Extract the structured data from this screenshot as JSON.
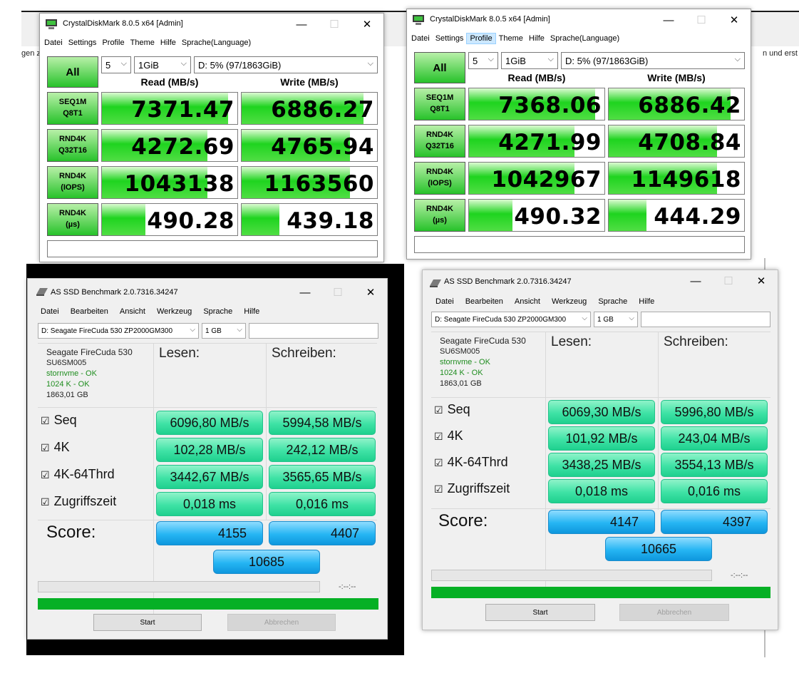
{
  "background": {
    "left_text": "gen z",
    "right_text": "n und erst"
  },
  "cdm_left": {
    "title": "CrystalDiskMark 8.0.5 x64 [Admin]",
    "menu": [
      "Datei",
      "Settings",
      "Profile",
      "Theme",
      "Hilfe",
      "Sprache(Language)"
    ],
    "all_label": "All",
    "count": "5",
    "size": "1GiB",
    "drive": "D: 5% (97/1863GiB)",
    "read_header": "Read (MB/s)",
    "write_header": "Write (MB/s)",
    "rows": [
      {
        "label1": "SEQ1M",
        "label2": "Q8T1",
        "read": "7371.47",
        "write": "6886.27",
        "read_fill": 0.93,
        "write_fill": 0.9
      },
      {
        "label1": "RND4K",
        "label2": "Q32T16",
        "read": "4272.69",
        "write": "4765.94",
        "read_fill": 0.78,
        "write_fill": 0.8
      },
      {
        "label1": "RND4K",
        "label2": "(IOPS)",
        "read": "1043138",
        "write": "1163560",
        "read_fill": 0.78,
        "write_fill": 0.8
      },
      {
        "label1": "RND4K",
        "label2": "(µs)",
        "read": "490.28",
        "write": "439.18",
        "read_fill": 0.32,
        "write_fill": 0.28
      }
    ]
  },
  "cdm_right": {
    "title": "CrystalDiskMark 8.0.5 x64 [Admin]",
    "menu": [
      "Datei",
      "Settings",
      "Profile",
      "Theme",
      "Hilfe",
      "Sprache(Language)"
    ],
    "all_label": "All",
    "count": "5",
    "size": "1GiB",
    "drive": "D: 5% (97/1863GiB)",
    "read_header": "Read (MB/s)",
    "write_header": "Write (MB/s)",
    "rows": [
      {
        "label1": "SEQ1M",
        "label2": "Q8T1",
        "read": "7368.06",
        "write": "6886.42",
        "read_fill": 0.93,
        "write_fill": 0.9
      },
      {
        "label1": "RND4K",
        "label2": "Q32T16",
        "read": "4271.99",
        "write": "4708.84",
        "read_fill": 0.78,
        "write_fill": 0.8
      },
      {
        "label1": "RND4K",
        "label2": "(IOPS)",
        "read": "1042967",
        "write": "1149618",
        "read_fill": 0.78,
        "write_fill": 0.8
      },
      {
        "label1": "RND4K",
        "label2": "(µs)",
        "read": "490.32",
        "write": "444.29",
        "read_fill": 0.32,
        "write_fill": 0.28
      }
    ]
  },
  "asssd_left": {
    "title": "AS SSD Benchmark 2.0.7316.34247",
    "menu": [
      "Datei",
      "Bearbeiten",
      "Ansicht",
      "Werkzeug",
      "Sprache",
      "Hilfe"
    ],
    "drive": "D: Seagate FireCuda 530 ZP2000GM300",
    "size": "1 GB",
    "info": {
      "model": "Seagate FireCuda 530",
      "firmware": "SU6SM005",
      "driver": "stornvme - OK",
      "align": "1024 K - OK",
      "capacity": "1863,01 GB"
    },
    "read_header": "Lesen:",
    "write_header": "Schreiben:",
    "rows": [
      {
        "label": "Seq",
        "read": "6096,80 MB/s",
        "write": "5994,58 MB/s"
      },
      {
        "label": "4K",
        "read": "102,28 MB/s",
        "write": "242,12 MB/s"
      },
      {
        "label": "4K-64Thrd",
        "read": "3442,67 MB/s",
        "write": "3565,65 MB/s"
      },
      {
        "label": "Zugriffszeit",
        "read": "0,018 ms",
        "write": "0,016 ms"
      }
    ],
    "score_label": "Score:",
    "score_read": "4155",
    "score_write": "4407",
    "score_total": "10685",
    "timer": "-:--:--",
    "start": "Start",
    "abort": "Abbrechen"
  },
  "asssd_right": {
    "title": "AS SSD Benchmark 2.0.7316.34247",
    "menu": [
      "Datei",
      "Bearbeiten",
      "Ansicht",
      "Werkzeug",
      "Sprache",
      "Hilfe"
    ],
    "drive": "D: Seagate FireCuda 530 ZP2000GM300",
    "size": "1 GB",
    "info": {
      "model": "Seagate FireCuda 530",
      "firmware": "SU6SM005",
      "driver": "stornvme - OK",
      "align": "1024 K - OK",
      "capacity": "1863,01 GB"
    },
    "read_header": "Lesen:",
    "write_header": "Schreiben:",
    "rows": [
      {
        "label": "Seq",
        "read": "6069,30 MB/s",
        "write": "5996,80 MB/s"
      },
      {
        "label": "4K",
        "read": "101,92 MB/s",
        "write": "243,04 MB/s"
      },
      {
        "label": "4K-64Thrd",
        "read": "3438,25 MB/s",
        "write": "3554,13 MB/s"
      },
      {
        "label": "Zugriffszeit",
        "read": "0,018 ms",
        "write": "0,016 ms"
      }
    ],
    "score_label": "Score:",
    "score_read": "4147",
    "score_write": "4397",
    "score_total": "10665",
    "timer": "-:--:--",
    "start": "Start",
    "abort": "Abbrechen"
  },
  "colors": {
    "cdm_green": "#27c22a",
    "asssd_green": "#3ee2a5",
    "asssd_blue": "#25b5f3",
    "progress_green": "#06b025"
  }
}
